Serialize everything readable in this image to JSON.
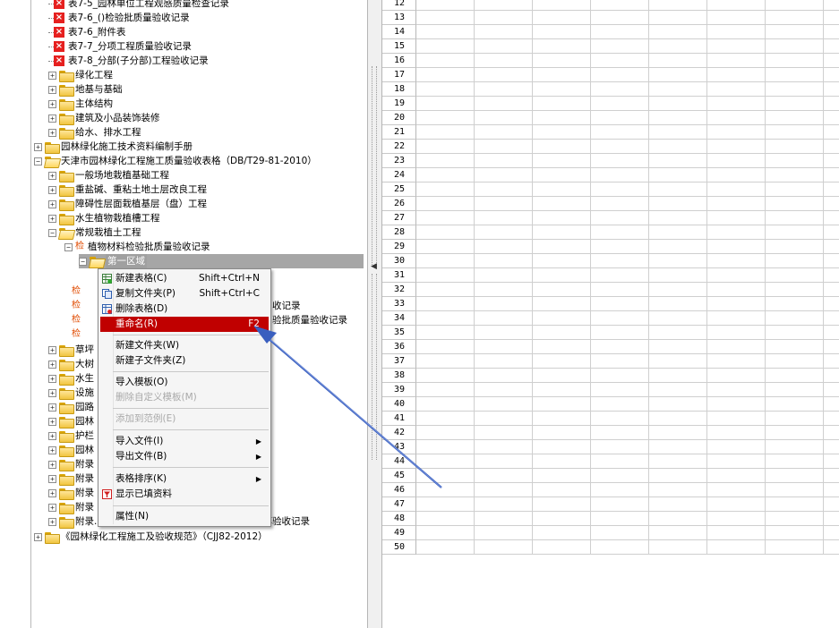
{
  "tree": {
    "items": [
      {
        "label": "表7-5_园林单位工程观感质量检查记录",
        "icon": "x-icon"
      },
      {
        "label": "表7-6_()检验批质量验收记录",
        "icon": "x-icon"
      },
      {
        "label": "表7-6_附件表",
        "icon": "x-icon"
      },
      {
        "label": "表7-7_分项工程质量验收记录",
        "icon": "x-icon"
      },
      {
        "label": "表7-8_分部(子分部)工程验收记录",
        "icon": "x-icon"
      },
      {
        "label": "绿化工程",
        "icon": "folder-icon"
      },
      {
        "label": "地基与基础",
        "icon": "folder-icon"
      },
      {
        "label": "主体结构",
        "icon": "folder-icon"
      },
      {
        "label": "建筑及小品装饰装修",
        "icon": "folder-icon"
      },
      {
        "label": "给水、排水工程",
        "icon": "folder-icon"
      },
      {
        "label": "园林绿化施工技术资料编制手册",
        "icon": "folder-icon"
      },
      {
        "label": "天津市园林绿化工程施工质量验收表格（DB/T29-81-2010）",
        "icon": "folder-open-icon"
      },
      {
        "label": "一般场地栽植基础工程",
        "icon": "folder-icon"
      },
      {
        "label": "重盐碱、重粘土地土层改良工程",
        "icon": "folder-icon"
      },
      {
        "label": "障碍性层面栽植基层（盘）工程",
        "icon": "folder-icon"
      },
      {
        "label": "水生植物栽植槽工程",
        "icon": "folder-icon"
      },
      {
        "label": "常规栽植土工程",
        "icon": "folder-open-icon"
      },
      {
        "label": "植物材料检验批质量验收记录",
        "icon": "jian-icon",
        "prefix": "检"
      },
      {
        "label": "第一区域",
        "icon": "folder-open-icon"
      },
      {
        "label": "收记录",
        "icon": "jian-icon",
        "prefix": "检"
      },
      {
        "label": "验批质量验收记录",
        "icon": "jian-icon",
        "prefix": "检"
      },
      {
        "label": "草坪",
        "icon": "folder-icon"
      },
      {
        "label": "大树",
        "icon": "folder-icon"
      },
      {
        "label": "水生",
        "icon": "folder-icon"
      },
      {
        "label": "设施",
        "icon": "folder-icon"
      },
      {
        "label": "园路",
        "icon": "folder-icon"
      },
      {
        "label": "园林",
        "icon": "folder-icon"
      },
      {
        "label": "护栏",
        "icon": "folder-icon"
      },
      {
        "label": "园林",
        "icon": "folder-icon"
      },
      {
        "label": "附录",
        "icon": "folder-icon"
      },
      {
        "label": "附录",
        "icon": "folder-icon"
      },
      {
        "label": "附录",
        "icon": "folder-icon"
      },
      {
        "label": "附录",
        "icon": "folder-icon"
      },
      {
        "label": "附录...单位（子单位）工程栽植成活（保留）率验收记录",
        "icon": "folder-icon"
      },
      {
        "label": "《园林绿化工程施工及验收规范》（CJJ82-2012）",
        "icon": "folder-icon"
      }
    ]
  },
  "grid": {
    "row_numbers": [
      "12",
      "13",
      "14",
      "15",
      "16",
      "17",
      "18",
      "19",
      "20",
      "21",
      "22",
      "23",
      "24",
      "25",
      "26",
      "27",
      "28",
      "29",
      "30",
      "31",
      "32",
      "33",
      "34",
      "35",
      "36",
      "37",
      "38",
      "39",
      "40",
      "41",
      "42",
      "43",
      "44",
      "45",
      "46",
      "47",
      "48",
      "49",
      "50"
    ]
  },
  "context_menu": {
    "items": [
      {
        "label": "新建表格(C)",
        "shortcut": "Shift+Ctrl+N",
        "icon": "new-table-icon",
        "enabled": true
      },
      {
        "label": "复制文件夹(P)",
        "shortcut": "Shift+Ctrl+C",
        "icon": "copy-folder-icon",
        "enabled": true
      },
      {
        "label": "删除表格(D)",
        "shortcut": "",
        "icon": "delete-table-icon",
        "enabled": true
      },
      {
        "label": "重命名(R)",
        "shortcut": "F2",
        "icon": "",
        "enabled": true,
        "highlighted": true
      },
      {
        "label": "新建文件夹(W)",
        "shortcut": "",
        "icon": "",
        "enabled": true
      },
      {
        "label": "新建子文件夹(Z)",
        "shortcut": "",
        "icon": "",
        "enabled": true
      },
      {
        "label": "导入模板(O)",
        "shortcut": "",
        "icon": "",
        "enabled": true
      },
      {
        "label": "删除自定义模板(M)",
        "shortcut": "",
        "icon": "",
        "enabled": false
      },
      {
        "label": "添加到范例(E)",
        "shortcut": "",
        "icon": "",
        "enabled": false
      },
      {
        "label": "导入文件(I)",
        "shortcut": "",
        "icon": "",
        "enabled": true,
        "submenu": true
      },
      {
        "label": "导出文件(B)",
        "shortcut": "",
        "icon": "",
        "enabled": true,
        "submenu": true
      },
      {
        "label": "表格排序(K)",
        "shortcut": "",
        "icon": "",
        "enabled": true,
        "submenu": true
      },
      {
        "label": "显示已填资料",
        "shortcut": "",
        "icon": "filter-icon",
        "enabled": true
      },
      {
        "label": "属性(N)",
        "shortcut": "",
        "icon": "",
        "enabled": true
      }
    ]
  },
  "annotation": {
    "type": "arrow",
    "color": "#3a5fbf",
    "points_to": "重命名(R)"
  },
  "colors": {
    "highlight": "#c00000",
    "x_icon": "#e6201f",
    "jian": "#e04b00",
    "arrow": "#3a5fbf"
  }
}
